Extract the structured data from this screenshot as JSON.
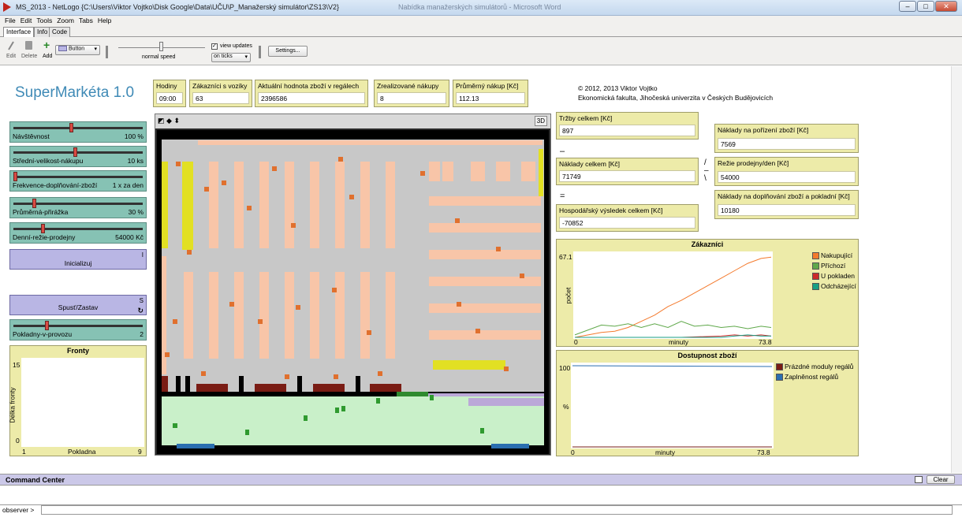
{
  "window": {
    "title": "MS_2013 - NetLogo {C:\\Users\\Viktor Vojtko\\Disk Google\\Data\\UČU\\P_Manažerský simulátor\\ZS13\\V2}",
    "minimize": "–",
    "maximize": "□",
    "close": "✕"
  },
  "menu": [
    "File",
    "Edit",
    "Tools",
    "Zoom",
    "Tabs",
    "Help"
  ],
  "tabs": [
    "Interface",
    "Info",
    "Code"
  ],
  "toolbar": {
    "edit": "Edit",
    "delete": "Delete",
    "add": "Add",
    "widget": "Button",
    "speed": "normal speed",
    "view_updates": "view updates",
    "update_mode": "on ticks",
    "settings": "Settings..."
  },
  "app_name": "SuperMarkéta 1.0",
  "monitors": [
    {
      "label": "Hodiny",
      "value": "09:00"
    },
    {
      "label": "Zákazníci s vozíky",
      "value": "63"
    },
    {
      "label": "Aktuální hodnota zboží v regálech",
      "value": "2396586"
    },
    {
      "label": "Zrealizované nákupy",
      "value": "8"
    },
    {
      "label": "Průměrný nákup [Kč]",
      "value": "112.13"
    }
  ],
  "credits": {
    "line1": "© 2012, 2013 Viktor Vojtko",
    "line2": "Ekonomická fakulta, Jihočeská univerzita v Českých Budějovicích"
  },
  "sliders": [
    {
      "label": "Návštěvnost",
      "value": "100 %",
      "pos": 0.45
    },
    {
      "label": "Střední-velikost-nákupu",
      "value": "10 ks",
      "pos": 0.48
    },
    {
      "label": "Frekvence-doplňování-zboží",
      "value": "1 x za den",
      "pos": 0.0
    },
    {
      "label": "Průměrná-přirážka",
      "value": "30 %",
      "pos": 0.15
    },
    {
      "label": "Denní-režie-prodejny",
      "value": "54000 Kč",
      "pos": 0.22
    },
    {
      "label": "Pokladny-v-provozu",
      "value": "2",
      "pos": 0.25
    }
  ],
  "buttons": {
    "init": {
      "label": "Inicializuj",
      "key": "I"
    },
    "run": {
      "label": "Spusť/Zastav",
      "key": "S",
      "forever": "↻"
    }
  },
  "view": {
    "three_d": "3D",
    "controls": "◩ ◆ ⬍"
  },
  "finance": {
    "trzby": {
      "label": "Tržby celkem [Kč]",
      "value": "897"
    },
    "naklady": {
      "label": "Náklady celkem [Kč]",
      "value": "71749"
    },
    "vysledek": {
      "label": "Hospodářský výsledek celkem [Kč]",
      "value": "-70852"
    },
    "porizeni": {
      "label": "Náklady na pořízení zboží [Kč]",
      "value": "7569"
    },
    "rezie": {
      "label": "Režie prodejny/den [Kč]",
      "value": "54000"
    },
    "doplnovani": {
      "label": "Náklady na doplňování zboží a pokladní [Kč]",
      "value": "10180"
    },
    "minus": "–",
    "equals": "=",
    "slash": "/",
    "dash": "–",
    "backslash": "\\"
  },
  "chart_data": [
    {
      "type": "line",
      "title": "Zákazníci",
      "xlabel": "minuty",
      "ylabel": "počet",
      "xlim": [
        0,
        73.8
      ],
      "ylim": [
        0,
        67.1
      ],
      "x_tick_labels": [
        "0",
        "73.8"
      ],
      "y_tick_labels": [
        "67.1"
      ],
      "series": [
        {
          "name": "Nakupující",
          "color": "#f47a2d",
          "x": [
            0,
            5,
            10,
            15,
            20,
            25,
            30,
            35,
            40,
            45,
            50,
            55,
            60,
            65,
            70,
            73.8
          ],
          "values": [
            0,
            2,
            4,
            5,
            8,
            13,
            18,
            25,
            30,
            36,
            42,
            48,
            54,
            60,
            64,
            65
          ]
        },
        {
          "name": "Příchozí",
          "color": "#5fa84a",
          "x": [
            0,
            5,
            10,
            15,
            20,
            25,
            30,
            35,
            40,
            45,
            50,
            55,
            60,
            65,
            70,
            73.8
          ],
          "values": [
            2,
            6,
            10,
            9,
            11,
            8,
            11,
            8,
            13,
            9,
            10,
            8,
            9,
            7,
            9,
            8
          ]
        },
        {
          "name": "U pokladen",
          "color": "#cc2a2a",
          "x": [
            0,
            20,
            40,
            55,
            60,
            65,
            70,
            73.8
          ],
          "values": [
            0,
            0,
            0,
            1,
            2,
            1,
            2,
            1
          ]
        },
        {
          "name": "Odcházející",
          "color": "#199f84",
          "x": [
            0,
            20,
            40,
            55,
            60,
            65,
            70,
            73.8
          ],
          "values": [
            0,
            0,
            0,
            0,
            1,
            2,
            1,
            1
          ]
        }
      ]
    },
    {
      "type": "line",
      "title": "Dostupnost zboží",
      "xlabel": "minuty",
      "ylabel": "%",
      "xlim": [
        0,
        73.8
      ],
      "ylim": [
        0,
        100
      ],
      "x_tick_labels": [
        "0",
        "73.8"
      ],
      "y_tick_labels": [
        "100"
      ],
      "series": [
        {
          "name": "Prázdné moduly regálů",
          "color": "#7a1c14",
          "x": [
            0,
            73.8
          ],
          "values": [
            0,
            0
          ]
        },
        {
          "name": "Zaplněnost regálů",
          "color": "#2a6eb0",
          "x": [
            0,
            73.8
          ],
          "values": [
            100,
            99
          ]
        }
      ]
    },
    {
      "type": "bar",
      "title": "Fronty",
      "xlabel": "Pokladna",
      "ylabel": "Délka fronty",
      "xlim": [
        1,
        9
      ],
      "ylim": [
        0,
        15
      ],
      "x_tick_labels": [
        "1",
        "9"
      ],
      "y_tick_labels": [
        "15",
        "0"
      ],
      "categories": [],
      "values": []
    }
  ],
  "command_center": {
    "title": "Command Center",
    "clear": "Clear",
    "prompt": "observer >"
  }
}
